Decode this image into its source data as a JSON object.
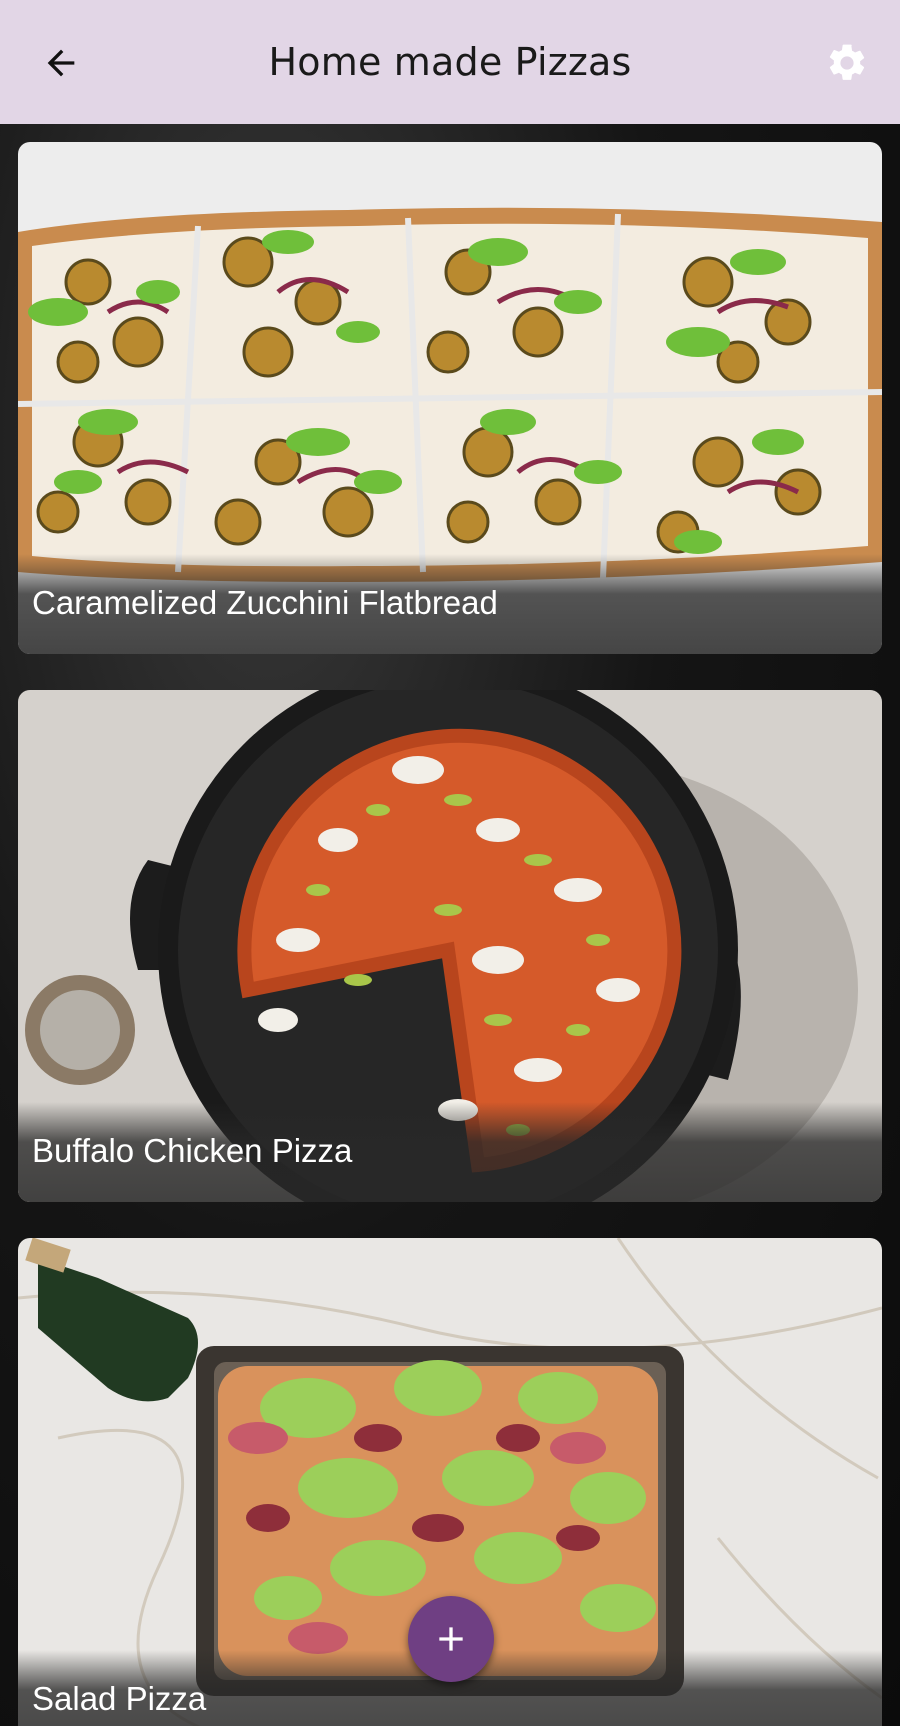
{
  "header": {
    "title": "Home made Pizzas",
    "back_icon": "arrow-left-icon",
    "settings_icon": "gear-icon",
    "background": "#e2d6e6"
  },
  "recipes": [
    {
      "name": "Caramelized Zucchini Flatbread",
      "image": "zucchini-flatbread-photo"
    },
    {
      "name": "Buffalo Chicken Pizza",
      "image": "buffalo-chicken-pizza-photo"
    },
    {
      "name": "Salad Pizza",
      "image": "salad-pizza-photo"
    }
  ],
  "fab": {
    "icon": "plus-icon",
    "color": "#6f3f83"
  }
}
